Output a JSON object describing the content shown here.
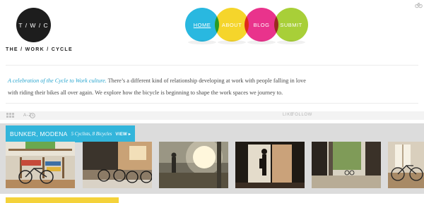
{
  "header": {
    "logo_text": "T / W / C",
    "tagline": "THE / WORK / CYCLE",
    "corner_icon": "cycle-icon"
  },
  "nav": {
    "items": [
      {
        "label": "HOME",
        "color": "#29b8e0",
        "active": true
      },
      {
        "label": "ABOUT",
        "color": "#f5d52b",
        "active": false
      },
      {
        "label": "BLOG",
        "color": "#e9338c",
        "active": false
      },
      {
        "label": "SUBMIT",
        "color": "#a8cf38",
        "active": false
      }
    ]
  },
  "intro": {
    "lead": "A celebration of the Cycle to Work culture.",
    "body": " There’s a different kind of relationship developing at work with people falling in love with riding their bikes all over again. We explore how the bicycle is beginning to shape the work spaces we journey to."
  },
  "toolbar": {
    "grid_icon": "grid-view-icon",
    "sort_label": "A-Z",
    "clock_icon": "clock-icon",
    "like_label": "LIKE",
    "follow_label": "FOLLOW"
  },
  "story": {
    "title": "BUNKER, MODENA",
    "meta": "5 Cyclists, 8 Bicycles",
    "view_label": "VIEW ▸",
    "accent": "#33b5db",
    "photos": [
      {
        "name": "photo-bike-shelves"
      },
      {
        "name": "photo-bikes-by-wall"
      },
      {
        "name": "photo-cyclist-sunlight"
      },
      {
        "name": "photo-doorway-silhouette"
      },
      {
        "name": "photo-courtyard-columns"
      },
      {
        "name": "photo-window-bike"
      }
    ]
  },
  "next_story": {
    "accent": "#f4d23a"
  }
}
